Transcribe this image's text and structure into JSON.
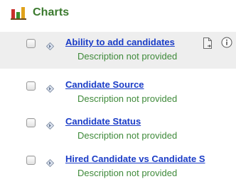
{
  "section": {
    "title": "Charts",
    "icon": "bar-chart-icon"
  },
  "items": [
    {
      "label": "Ability to add candidates",
      "description": "Description not provided"
    },
    {
      "label": "Candidate Source",
      "description": "Description not provided"
    },
    {
      "label": "Candidate Status",
      "description": "Description not provided"
    },
    {
      "label": "Hired Candidate vs Candidate S",
      "description": "Description not provided"
    }
  ],
  "colors": {
    "title_green": "#3b7a2e",
    "link_blue": "#1a3cc7",
    "desc_green": "#3f8a3a",
    "highlight_gray": "#eeeeee"
  }
}
